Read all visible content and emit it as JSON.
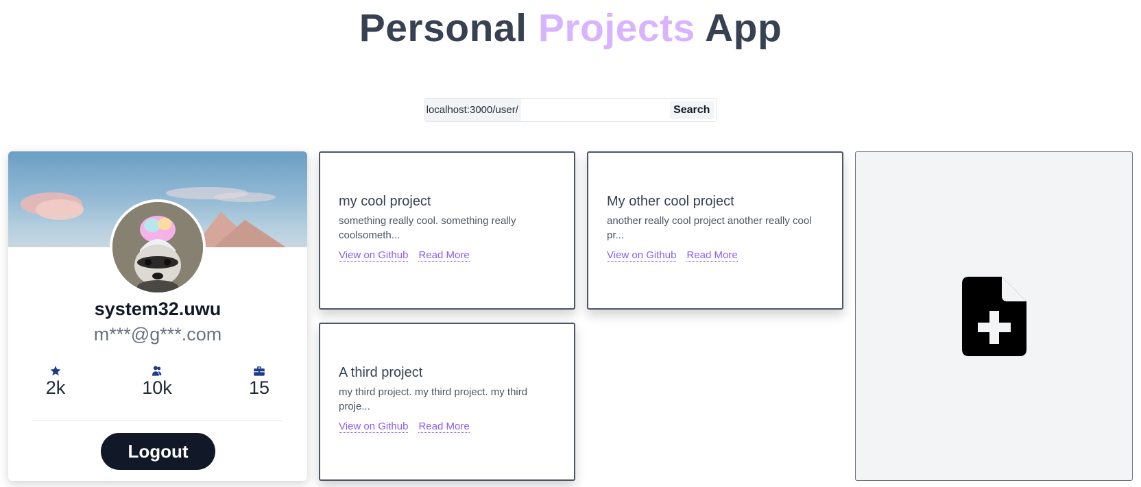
{
  "header": {
    "title_part1": "Personal",
    "title_accent": "Projects",
    "title_part2": "App"
  },
  "search": {
    "prefix": "localhost:3000/user/",
    "value": "",
    "button_label": "Search"
  },
  "profile": {
    "username": "system32.uwu",
    "email": "m***@g***.com",
    "stats": [
      {
        "icon": "star-icon",
        "value": "2k"
      },
      {
        "icon": "users-icon",
        "value": "10k"
      },
      {
        "icon": "briefcase-icon",
        "value": "15"
      }
    ],
    "logout_label": "Logout"
  },
  "projects": [
    {
      "title": "my cool project",
      "description": "something really cool. something really coolsometh...",
      "github_label": "View on Github",
      "readmore_label": "Read More"
    },
    {
      "title": "My other cool project",
      "description": "another really cool project another really cool pr...",
      "github_label": "View on Github",
      "readmore_label": "Read More"
    },
    {
      "title": "A third project",
      "description": "my third project. my third project. my third proje...",
      "github_label": "View on Github",
      "readmore_label": "Read More"
    }
  ],
  "add_project": {
    "icon": "file-plus-icon"
  },
  "colors": {
    "title": "#374151",
    "accent": "#d8b4fe",
    "link": "#8b5cf6",
    "stat_icon": "#1e3a8a",
    "dark_button": "#111827"
  }
}
